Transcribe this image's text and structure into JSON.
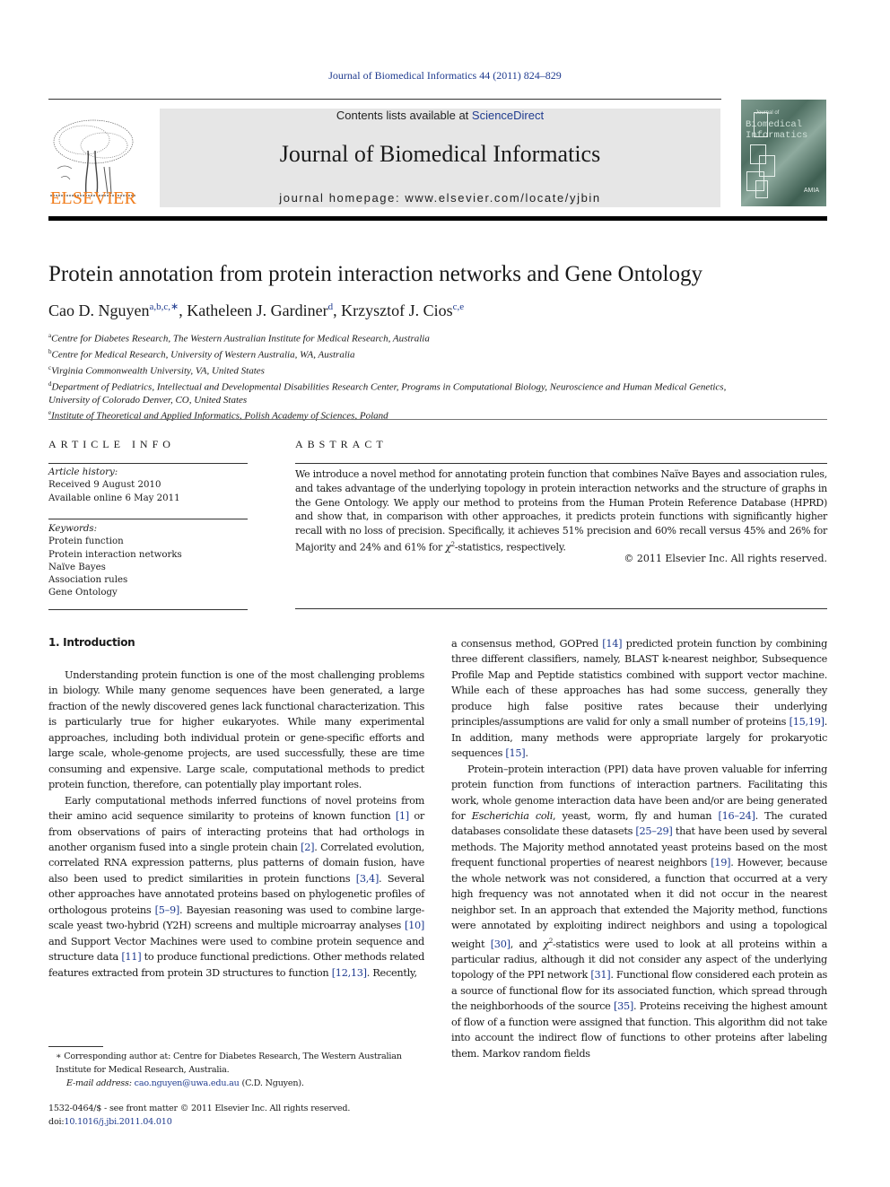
{
  "header": {
    "running_head": "Journal of Biomedical Informatics 44 (2011) 824–829",
    "contents_prefix": "Contents lists available at ",
    "contents_link": "ScienceDirect",
    "journal_title": "Journal of Biomedical Informatics",
    "homepage": "journal homepage: www.elsevier.com/locate/yjbin",
    "publisher_logo_text": "ELSEVIER",
    "cover": {
      "small_text": "Journal of",
      "title_line1": "Biomedical",
      "title_line2": "Informatics",
      "society": "AMIA"
    }
  },
  "article": {
    "title": "Protein annotation from protein interaction networks and Gene Ontology",
    "authors": [
      {
        "name": "Cao D. Nguyen",
        "sup": "a,b,c,∗"
      },
      {
        "name": "Katheleen J. Gardiner",
        "sup": "d"
      },
      {
        "name": "Krzysztof J. Cios",
        "sup": "c,e"
      }
    ],
    "affiliations": [
      {
        "key": "a",
        "text": "Centre for Diabetes Research, The Western Australian Institute for Medical Research, Australia"
      },
      {
        "key": "b",
        "text": "Centre for Medical Research, University of Western Australia, WA, Australia"
      },
      {
        "key": "c",
        "text": "Virginia Commonwealth University, VA, United States"
      },
      {
        "key": "d",
        "text": "Department of Pediatrics, Intellectual and Developmental Disabilities Research Center, Programs in Computational Biology, Neuroscience and Human Medical Genetics, University of Colorado Denver, CO, United States"
      },
      {
        "key": "e",
        "text": "Institute of Theoretical and Applied Informatics, Polish Academy of Sciences, Poland"
      }
    ]
  },
  "article_info": {
    "label": "ARTICLE INFO",
    "history_label": "Article history:",
    "received": "Received 9 August 2010",
    "available": "Available online 6 May 2011",
    "keywords_label": "Keywords:",
    "keywords": [
      "Protein function",
      "Protein interaction networks",
      "Naïve Bayes",
      "Association rules",
      "Gene Ontology"
    ]
  },
  "abstract": {
    "label": "ABSTRACT",
    "text_part1": "We introduce a novel method for annotating protein function that combines Naïve Bayes and association rules, and takes advantage of the underlying topology in protein interaction networks and the structure of graphs in the Gene Ontology. We apply our method to proteins from the Human Protein Reference Database (HPRD) and show that, in comparison with other approaches, it predicts protein functions with significantly higher recall with no loss of precision. Specifically, it achieves 51% precision and 60% recall versus 45% and 26% for Majority and 24% and 61% for ",
    "chi": "χ",
    "chi_sup": "2",
    "text_part2": "-statistics, respectively.",
    "copyright": "© 2011 Elsevier Inc. All rights reserved."
  },
  "body": {
    "section_heading": "1. Introduction",
    "left_paragraphs": [
      [
        {
          "t": "Understanding protein function is one of the most challenging problems in biology. While many genome sequences have been generated, a large fraction of the newly discovered genes lack functional characterization. This is particularly true for higher eukaryotes. While many experimental approaches, including both individual protein or gene-specific efforts and large scale, whole-genome projects, are used successfully, these are time consuming and expensive. Large scale, computational methods to predict protein function, therefore, can potentially play important roles."
        }
      ],
      [
        {
          "t": "Early computational methods inferred functions of novel proteins from their amino acid sequence similarity to proteins of known function "
        },
        {
          "ref": "[1]"
        },
        {
          "t": " or from observations of pairs of interacting proteins that had orthologs in another organism fused into a single protein chain "
        },
        {
          "ref": "[2]"
        },
        {
          "t": ". Correlated evolution, correlated RNA expression patterns, plus patterns of domain fusion, have also been used to predict similarities in protein functions "
        },
        {
          "ref": "[3,4]"
        },
        {
          "t": ". Several other approaches have annotated proteins based on phylogenetic profiles of orthologous proteins "
        },
        {
          "ref": "[5–9]"
        },
        {
          "t": ". Bayesian reasoning was used to combine large-scale yeast two-hybrid (Y2H) screens and multiple microarray analyses "
        },
        {
          "ref": "[10]"
        },
        {
          "t": " and Support Vector Machines were used to combine protein sequence and structure data "
        },
        {
          "ref": "[11]"
        },
        {
          "t": " to produce functional predictions. Other methods related features extracted from protein 3D structures to function "
        },
        {
          "ref": "[12,13]"
        },
        {
          "t": ". Recently,"
        }
      ]
    ],
    "right_paragraphs": [
      [
        {
          "t": "a consensus method, GOPred "
        },
        {
          "ref": "[14]"
        },
        {
          "t": " predicted protein function by combining three different classifiers, namely, BLAST k-nearest neighbor, Subsequence Profile Map and Peptide statistics combined with support vector machine. While each of these approaches has had some success, generally they produce high false positive rates because their underlying principles/assumptions are valid for only a small number of proteins "
        },
        {
          "ref": "[15,19]"
        },
        {
          "t": ". In addition, many methods were appropriate largely for prokaryotic sequences "
        },
        {
          "ref": "[15]"
        },
        {
          "t": "."
        }
      ],
      [
        {
          "t": "Protein–protein interaction (PPI) data have proven valuable for inferring protein function from functions of interaction partners. Facilitating this work, whole genome interaction data have been and/or are being generated for "
        },
        {
          "it": "Escherichia coli"
        },
        {
          "t": ", yeast, worm, fly and human "
        },
        {
          "ref": "[16–24]"
        },
        {
          "t": ". The curated databases consolidate these datasets "
        },
        {
          "ref": "[25–29]"
        },
        {
          "t": " that have been used by several methods. The Majority method annotated yeast proteins based on the most frequent functional properties of nearest neighbors "
        },
        {
          "ref": "[19]"
        },
        {
          "t": ". However, because the whole network was not considered, a function that occurred at a very high frequency was not annotated when it did not occur in the nearest neighbor set. In an approach that extended the Majority method, functions were annotated by exploiting indirect neighbors and using a topological weight "
        },
        {
          "ref": "[30]"
        },
        {
          "t": ", and "
        },
        {
          "chi": "χ",
          "sup": "2"
        },
        {
          "t": "-statistics were used to look at all proteins within a particular radius, although it did not consider any aspect of the underlying topology of the PPI network "
        },
        {
          "ref": "[31]"
        },
        {
          "t": ". Functional flow considered each protein as a source of functional flow for its associated function, which spread through the neighborhoods of the source "
        },
        {
          "ref": "[35]"
        },
        {
          "t": ". Proteins receiving the highest amount of flow of a function were assigned that function. This algorithm did not take into account the indirect flow of functions to other proteins after labeling them. Markov random fields"
        }
      ]
    ]
  },
  "footnote": {
    "marker": "∗",
    "corresponding": "Corresponding author at: Centre for Diabetes Research, The Western Australian Institute for Medical Research, Australia.",
    "email_label": "E-mail address:",
    "email": "cao.nguyen@uwa.edu.au",
    "email_suffix": " (C.D. Nguyen).",
    "front_matter": "1532-0464/$ - see front matter © 2011 Elsevier Inc. All rights reserved.",
    "doi_prefix": "doi:",
    "doi": "10.1016/j.jbi.2011.04.010"
  },
  "colors": {
    "link": "#1f3b8f",
    "elsevier_orange": "#f07c1b",
    "masthead_bg": "#e6e6e6"
  }
}
